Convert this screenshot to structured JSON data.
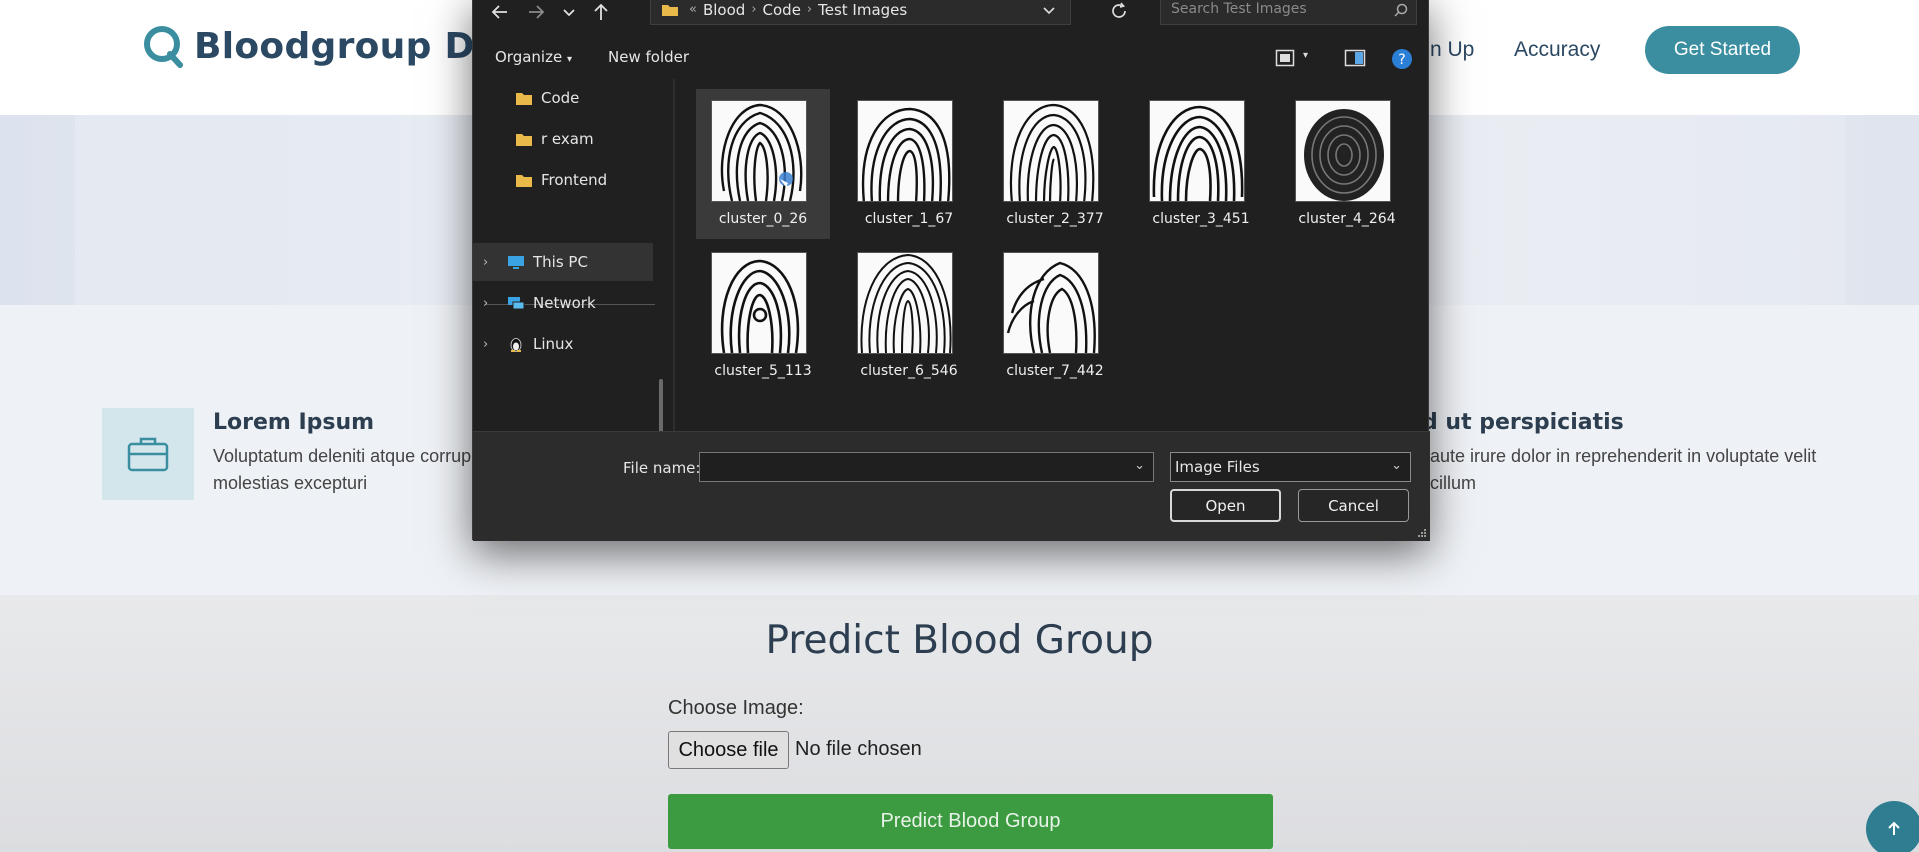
{
  "site": {
    "brand": "Bloodgroup Det",
    "nav": [
      "n Up",
      "Accuracy"
    ],
    "cta": "Get Started",
    "features": [
      {
        "title": "Lorem Ipsum",
        "desc_line1": "Voluptatum deleniti atque corrup",
        "desc_line2": "molestias excepturi"
      },
      {
        "title": "d ut perspiciatis",
        "desc_line1": "aute irure dolor in reprehenderit in voluptate velit",
        "desc_line2": "cillum"
      }
    ],
    "predict": {
      "title": "Predict Blood Group",
      "choose_label": "Choose Image:",
      "choose_button": "Choose file",
      "no_file": "No file chosen",
      "submit": "Predict Blood Group"
    }
  },
  "dialog": {
    "breadcrumb": [
      "Blood",
      "Code",
      "Test Images"
    ],
    "breadcrumb_overflow": "«",
    "search_placeholder": "Search Test Images",
    "commands": {
      "organize": "Organize",
      "new_folder": "New folder"
    },
    "nav_items": [
      {
        "label": "Code",
        "icon": "folder-icon"
      },
      {
        "label": "r exam",
        "icon": "folder-icon"
      },
      {
        "label": "Frontend",
        "icon": "folder-icon"
      },
      {
        "label": "This PC",
        "icon": "computer-icon",
        "selected": true
      },
      {
        "label": "Network",
        "icon": "network-icon"
      },
      {
        "label": "Linux",
        "icon": "linux-penguin-icon"
      }
    ],
    "files": [
      {
        "name": "cluster_0_26",
        "selected": true
      },
      {
        "name": "cluster_1_67"
      },
      {
        "name": "cluster_2_377"
      },
      {
        "name": "cluster_3_451"
      },
      {
        "name": "cluster_4_264"
      },
      {
        "name": "cluster_5_113"
      },
      {
        "name": "cluster_6_546"
      },
      {
        "name": "cluster_7_442"
      }
    ],
    "file_name_label": "File name:",
    "file_name_value": "",
    "file_type": "Image Files",
    "open": "Open",
    "cancel": "Cancel"
  },
  "colors": {
    "accent": "#3a8ea0",
    "predict_green": "#3c9a40",
    "brand_text": "#2c4964"
  }
}
